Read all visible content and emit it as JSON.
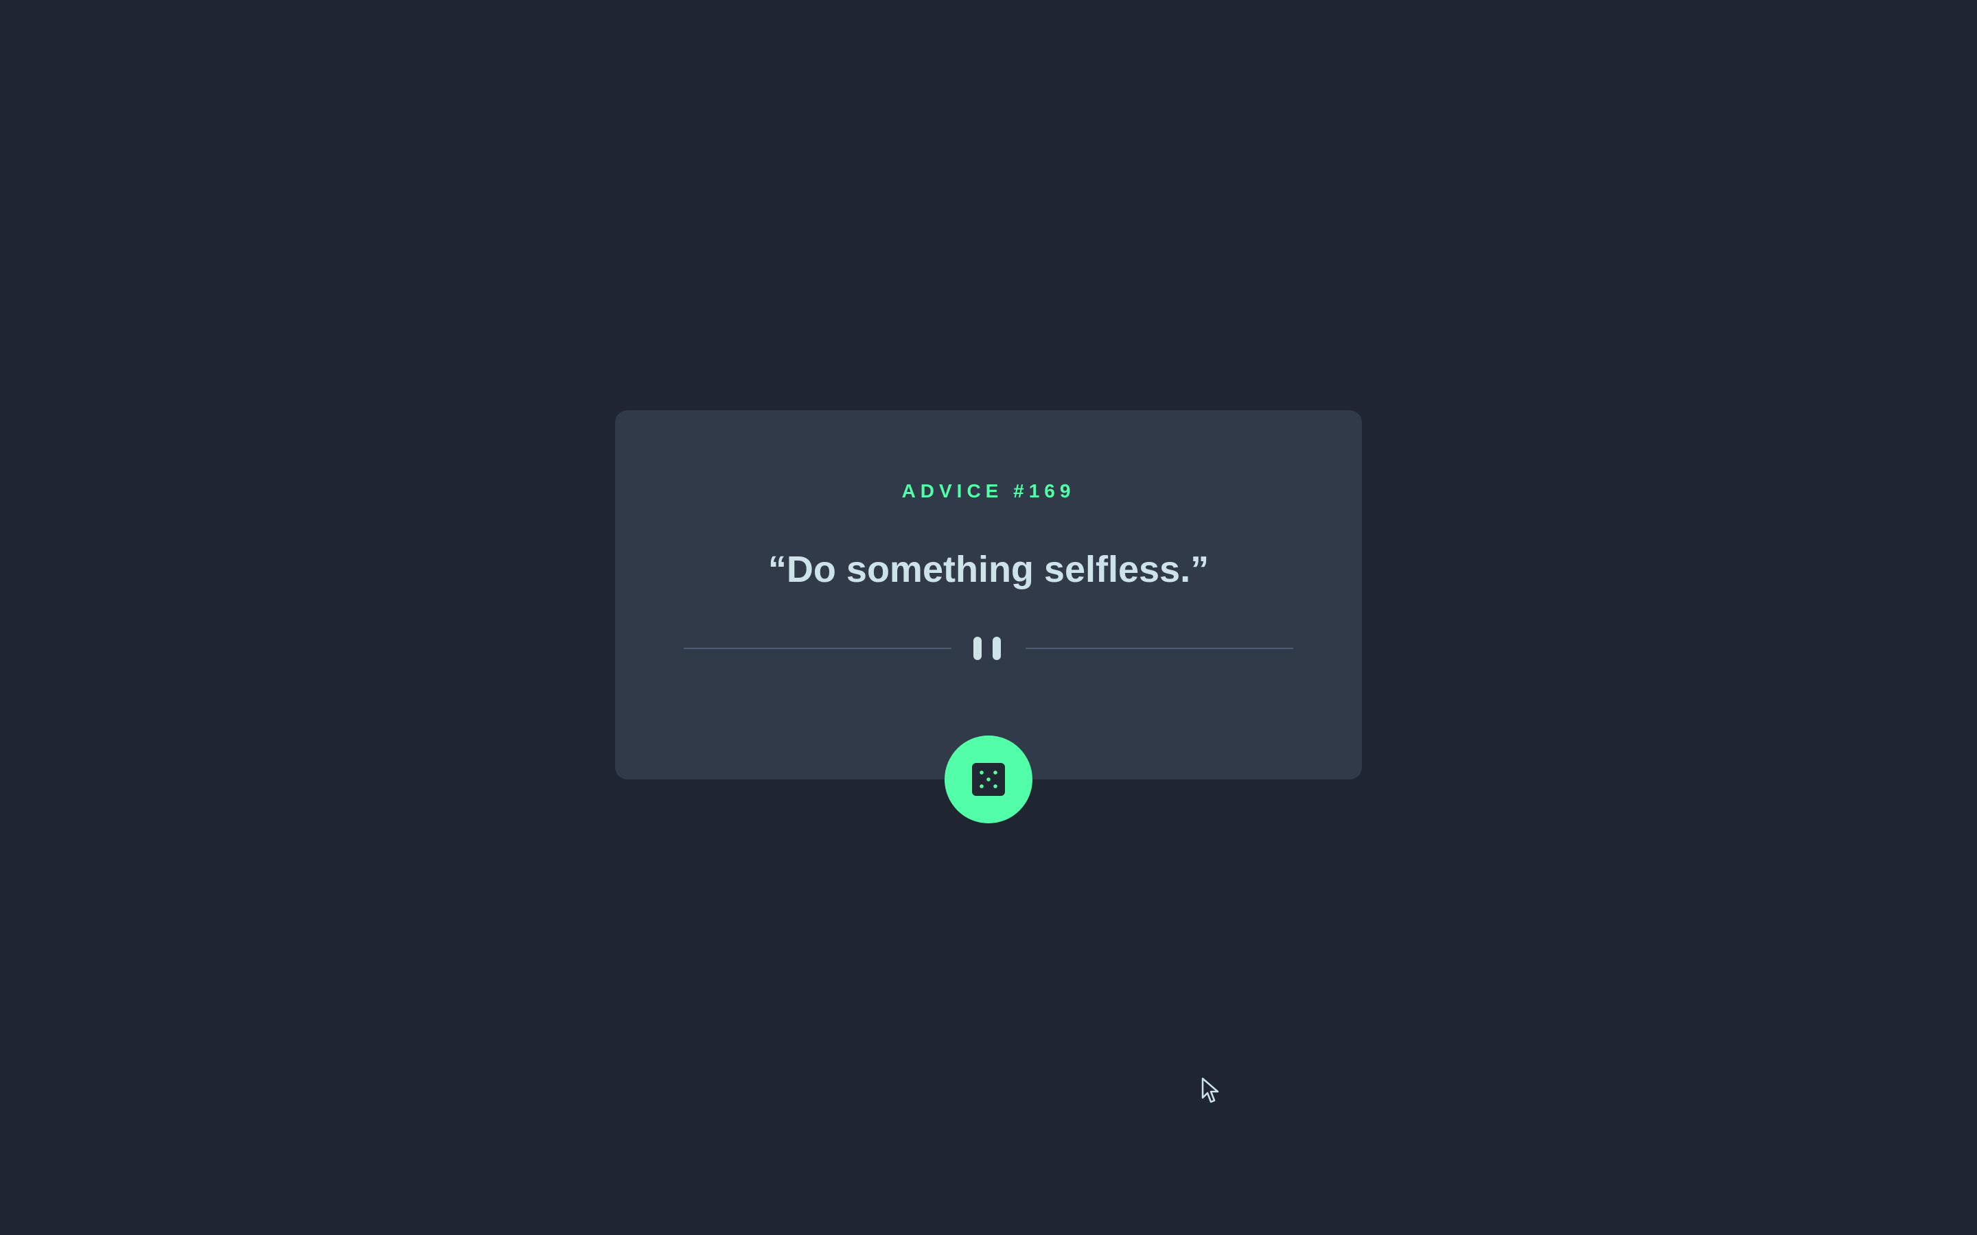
{
  "card": {
    "advice_label": "ADVICE #169",
    "quote": "“Do something selfless.”"
  },
  "icons": {
    "divider_icon": "pause-icon",
    "button_icon": "dice-icon",
    "cursor_icon": "mouse-cursor-icon"
  },
  "colors": {
    "background": "#1f2632",
    "card": "#313a49",
    "accent": "#52ffa8",
    "text": "#cee3e9",
    "divider": "#4f5d74"
  }
}
